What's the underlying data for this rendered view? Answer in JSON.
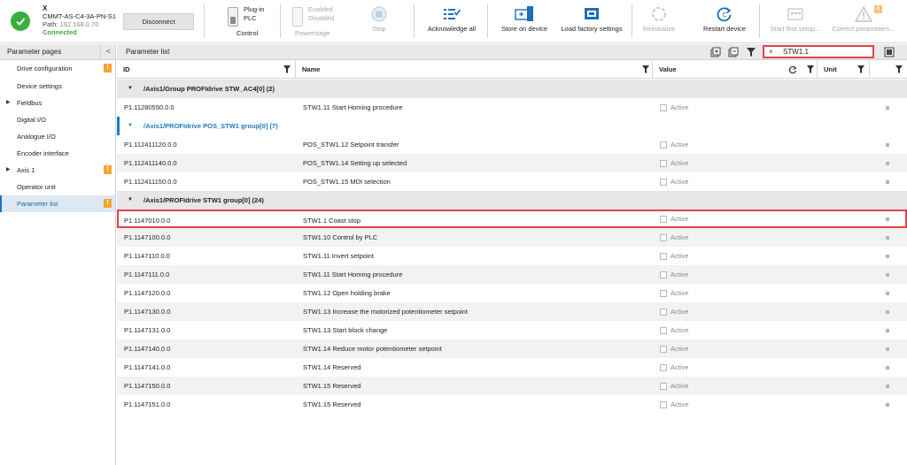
{
  "device": {
    "name": "X",
    "model": "CMMT-AS-C4-3A-PN-S1",
    "path_label": "Path:",
    "path_value": "192.168.0.70",
    "status": "Connected",
    "disconnect_label": "Disconnect"
  },
  "toolbar": {
    "plugin_label": "Plug-in",
    "plc_label": "PLC",
    "control_label": "Control",
    "enabled_label": "Enabled",
    "disabled_label": "Disabled",
    "powerstage_label": "Powerstage",
    "stop_label": "Stop",
    "acknowledge_label": "Acknowledge all",
    "store_label": "Store on device",
    "factory_label": "Load factory settings",
    "reinit_label": "Reinitialize",
    "restart_label": "Restart device",
    "first_setup_label": "Start first setup...",
    "correct_label": "Correct parameters...",
    "correct_badge": "6"
  },
  "sidebar": {
    "title": "Parameter pages",
    "collapse": "<",
    "items": [
      {
        "label": "Drive configuration",
        "warn": "!"
      },
      {
        "label": "Device settings"
      },
      {
        "label": "Fieldbus",
        "arrow": "▶"
      },
      {
        "label": "Digital I/O"
      },
      {
        "label": "Analogue I/O"
      },
      {
        "label": "Encoder interface"
      },
      {
        "label": "Axis 1",
        "arrow": "▶",
        "warn": "!"
      },
      {
        "label": "Operator unit"
      },
      {
        "label": "Parameter list",
        "warn": "!",
        "active": true
      }
    ]
  },
  "main": {
    "title": "Parameter list",
    "filter_value": "STW1.1",
    "filter_clear": "×",
    "columns": {
      "id": "ID",
      "name": "Name",
      "value": "Value",
      "unit": "Unit"
    },
    "active_label": "Active",
    "groups": [
      {
        "title": "/Axis1/Group PROFIdrive STW_AC4[0] (2)",
        "rows": [
          {
            "id": "P1.11280550.0.0",
            "name": "STW1.11 Start Homing procedure"
          }
        ]
      },
      {
        "title": "/Axis1/PROFIdrive POS_STW1 group[0] (7)",
        "rows": [
          {
            "id": "P1.112411120.0.0",
            "name": "POS_STW1.12 Setpoint transfer"
          },
          {
            "id": "P1.112411140.0.0",
            "name": "POS_STW1.14 Setting up selected"
          },
          {
            "id": "P1.112411150.0.0",
            "name": "POS_STW1.15 MDI selection"
          }
        ]
      },
      {
        "title": "/Axis1/PROFIdrive STW1 group[0] (24)",
        "rows": [
          {
            "id": "P1.1147010.0.0",
            "name": "STW1.1 Coast stop"
          },
          {
            "id": "P1.1147100.0.0",
            "name": "STW1.10 Control by PLC"
          },
          {
            "id": "P1.1147110.0.0",
            "name": "STW1.11 Invert setpoint"
          },
          {
            "id": "P1.1147111.0.0",
            "name": "STW1.11 Start Homing procedure"
          },
          {
            "id": "P1.1147120.0.0",
            "name": "STW1.12 Open holding brake"
          },
          {
            "id": "P1.1147130.0.0",
            "name": "STW1.13 Increase the motorized potentiometer setpoint"
          },
          {
            "id": "P1.1147131.0.0",
            "name": "STW1.13 Start block change"
          },
          {
            "id": "P1.1147140.0.0",
            "name": "STW1.14 Reduce motor potentiometer setpoint"
          },
          {
            "id": "P1.1147141.0.0",
            "name": "STW1.14 Reserved"
          },
          {
            "id": "P1.1147150.0.0",
            "name": "STW1.15 Reserved"
          },
          {
            "id": "P1.1147151.0.0",
            "name": "STW1.15 Reserved"
          }
        ]
      }
    ]
  }
}
